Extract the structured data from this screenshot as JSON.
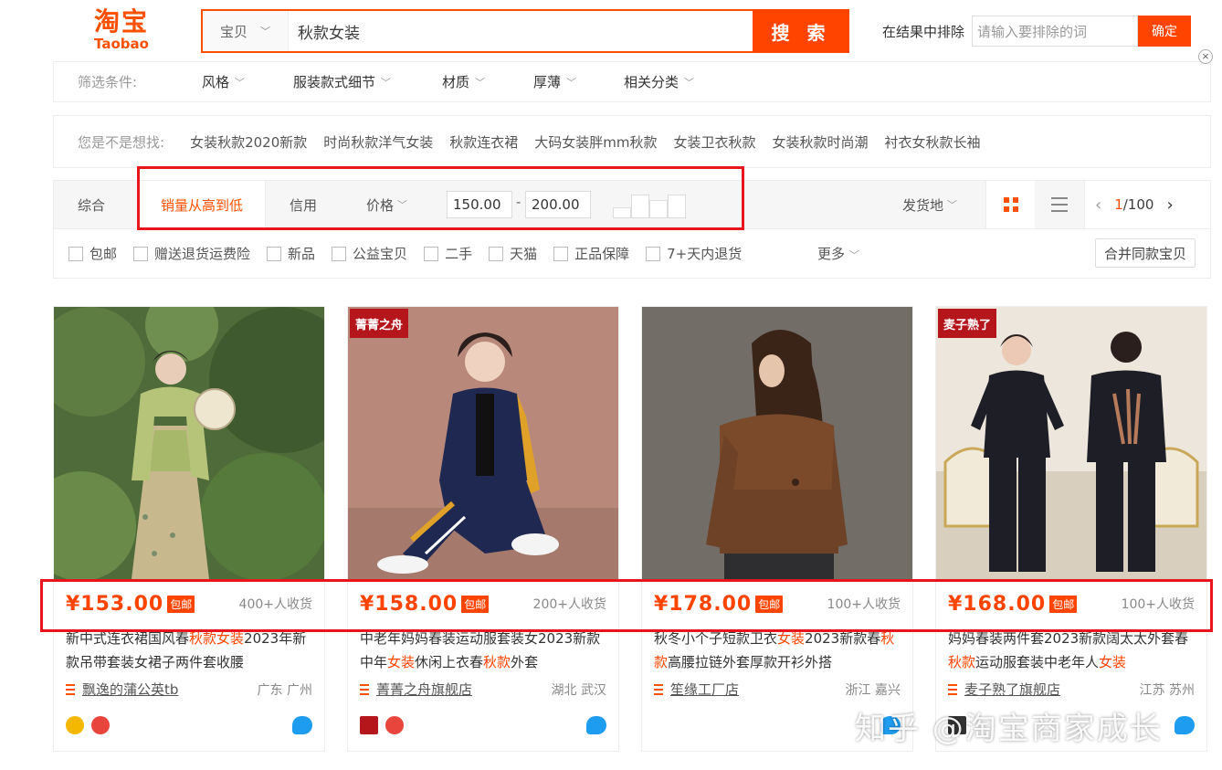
{
  "header": {
    "logo_cn": "淘宝",
    "logo_en": "Taobao",
    "search_scope": "宝贝",
    "search_query": "秋款女装",
    "search_button": "搜 索",
    "exclude_label": "在结果中排除",
    "exclude_placeholder": "请输入要排除的词",
    "exclude_button": "确定",
    "close_glyph": "×"
  },
  "filters": {
    "label": "筛选条件:",
    "items": [
      "风格",
      "服装款式细节",
      "材质",
      "厚薄",
      "相关分类"
    ]
  },
  "suggest": {
    "label": "您是不是想找:",
    "items": [
      "女装秋款2020新款",
      "时尚秋款洋气女装",
      "秋款连衣裙",
      "大码女装胖mm秋款",
      "女装卫衣秋款",
      "女装秋款时尚潮",
      "衬衣女秋款长袖"
    ]
  },
  "sortbar": {
    "tabs": [
      "综合",
      "销量从高到低",
      "信用",
      "价格"
    ],
    "price_min": "150.00",
    "price_max": "200.00",
    "price_dash": "-",
    "ship_from": "发货地",
    "page_current": "1",
    "page_total": "/100"
  },
  "checks": {
    "items": [
      "包邮",
      "赠送退货运费险",
      "新品",
      "公益宝贝",
      "二手",
      "天猫",
      "正品保障",
      "7+天内退货"
    ],
    "more": "更多",
    "merge_button": "合并同款宝贝"
  },
  "products": [
    {
      "price": "¥153.00",
      "tag": "包邮",
      "sales": "400+人收货",
      "title_a": "新中式连衣裙国风春",
      "title_hl1": "秋款女装",
      "title_b": "2023年新款吊带套装女裙子两件套收腰",
      "shop": "飘逸的蒲公英tb",
      "location": "广东 广州"
    },
    {
      "price": "¥158.00",
      "tag": "包邮",
      "sales": "200+人收货",
      "badge": "菁菁之舟",
      "title_a": "中老年妈妈春装运动服套装女2023新款中年",
      "title_hl1": "女装",
      "title_b": "休闲上衣春",
      "title_hl2": "秋款",
      "title_c": "外套",
      "shop": "菁菁之舟旗舰店",
      "location": "湖北 武汉"
    },
    {
      "price": "¥178.00",
      "tag": "包邮",
      "sales": "100+人收货",
      "title_a": "秋冬小个子短款卫衣",
      "title_hl1": "女装",
      "title_b": "2023新款春",
      "title_hl2": "秋款",
      "title_c": "高腰拉链外套厚款开衫外搭",
      "shop": "笙缘工厂店",
      "location": "浙江 嘉兴"
    },
    {
      "price": "¥168.00",
      "tag": "包邮",
      "sales": "100+人收货",
      "badge": "麦子熟了",
      "title_a": "妈妈春装两件套2023新款阔太太外套春",
      "title_hl1": "秋款",
      "title_b": "运动服套装中老年人",
      "title_hl2": "女装",
      "shop": "麦子熟了旗舰店",
      "location": "江苏 苏州"
    }
  ],
  "watermark": "知乎 @淘宝商家成长",
  "colors": {
    "accent": "#ff4400",
    "annotation_red": "#e8151d"
  }
}
